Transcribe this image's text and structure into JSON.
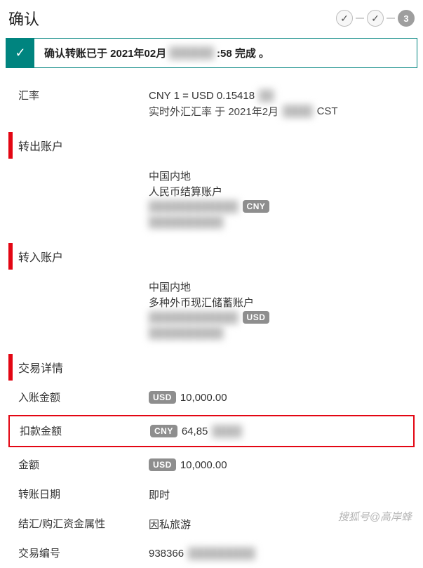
{
  "header": {
    "title": "确认",
    "current_step": "3"
  },
  "banner": {
    "prefix": "确认转账已于 2021年02月",
    "redacted": "██████",
    "suffix": ":58 完成 。"
  },
  "rate": {
    "label": "汇率",
    "line1": "CNY 1 = USD 0.15418",
    "line2_prefix": "实时外汇汇率 于 2021年2月",
    "line2_redacted": "████",
    "line2_suffix": " CST"
  },
  "from": {
    "section": "转出账户",
    "region": "中国内地",
    "type": "人民币结算账户",
    "acct_redacted": "████████████",
    "currency_badge": "CNY"
  },
  "to": {
    "section": "转入账户",
    "region": "中国内地",
    "type": "多种外币现汇储蓄账户",
    "acct_redacted": "████████████",
    "currency_badge": "USD"
  },
  "details": {
    "section": "交易详情",
    "rows": {
      "credit": {
        "label": "入账金额",
        "badge": "USD",
        "value": "10,000.00"
      },
      "debit": {
        "label": "扣款金额",
        "badge": "CNY",
        "value_visible": "64,85",
        "value_redacted": "████"
      },
      "amount": {
        "label": "金额",
        "badge": "USD",
        "value": "10,000.00"
      },
      "date": {
        "label": "转账日期",
        "value": "即时"
      },
      "nature": {
        "label": "结汇/购汇资金属性",
        "value": "因私旅游"
      },
      "txn": {
        "label": "交易编号",
        "value_visible": "938366",
        "value_redacted": "█████████"
      }
    }
  },
  "watermark": "搜狐号@高岸蜂"
}
